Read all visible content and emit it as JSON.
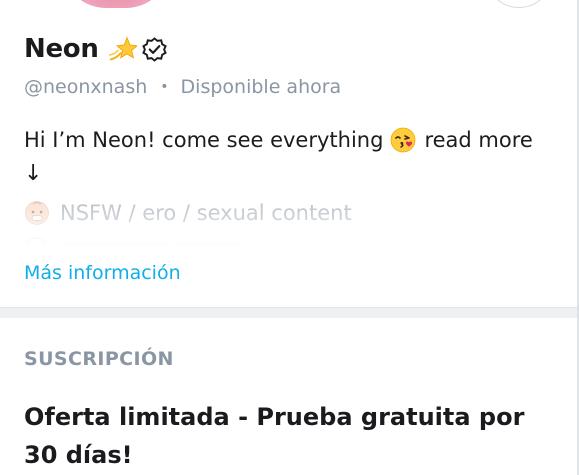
{
  "profile": {
    "name": "Neon",
    "handle": "@neonxnash",
    "separator": "•",
    "status": "Disponible ahora",
    "bio_text": "Hi I’m Neon! come see everything",
    "bio_read_more": "read more",
    "bio_arrow": "↓",
    "faded_line": "NSFW / ero / sexual content",
    "more_info_link": "Más información",
    "icons": [
      "dizzy-icon",
      "verified-icon",
      "kissing-face-icon",
      "baby-face-icon"
    ],
    "colors": {
      "link": "#12aee8",
      "muted": "#8a96a3",
      "avatar_pink": "#ec9cb4"
    }
  },
  "subscription": {
    "section_title": "SUSCRIPCIÓN",
    "offer_text": "Oferta limitada - Prueba gratuita por 30 días!"
  }
}
